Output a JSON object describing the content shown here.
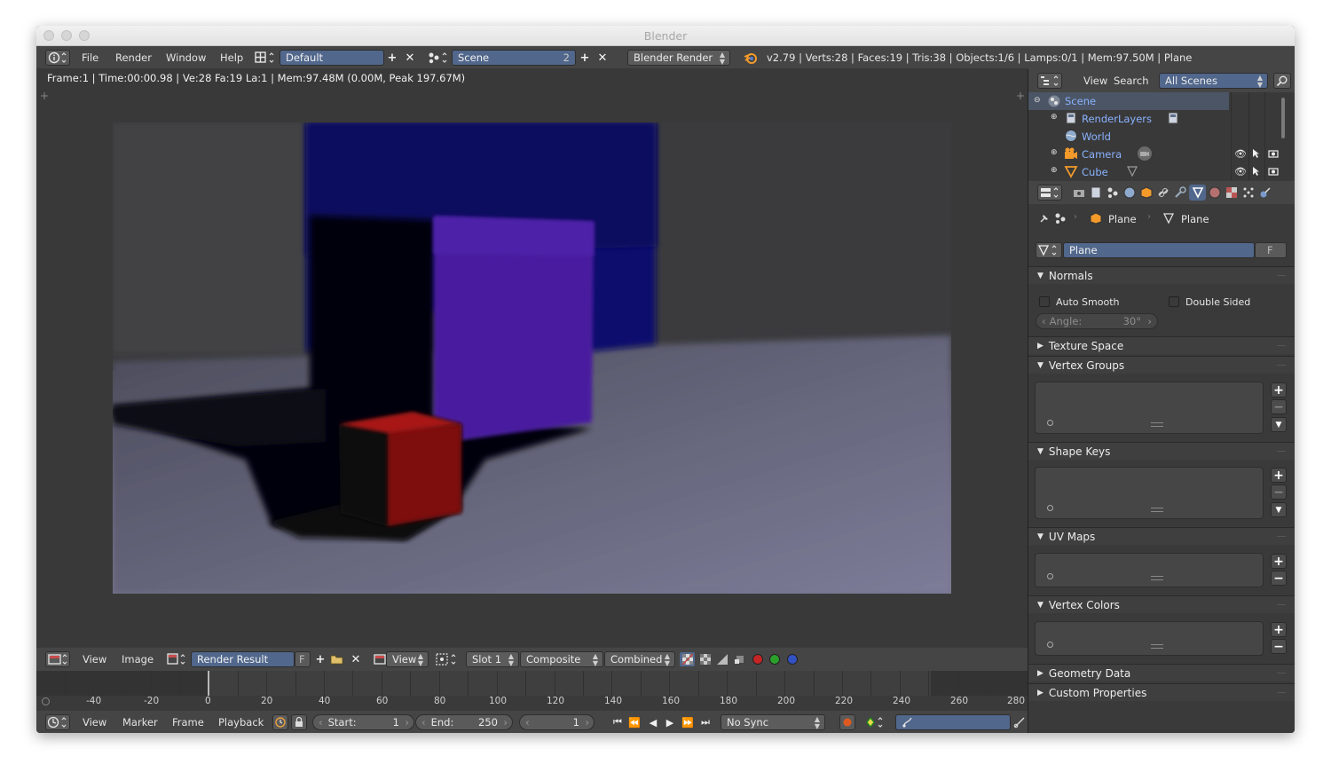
{
  "window": {
    "title": "Blender"
  },
  "menubar": {
    "items": [
      "File",
      "Render",
      "Window",
      "Help"
    ],
    "layout": "Default",
    "scene": "Scene",
    "scene_users": "2",
    "engine": "Blender Render",
    "stats": "v2.79 | Verts:28 | Faces:19 | Tris:38 | Objects:1/6 | Lamps:0/1 | Mem:97.50M | Plane"
  },
  "image_editor": {
    "info": "Frame:1 | Time:00:00.98 | Ve:28 Fa:19 La:1 | Mem:97.48M (0.00M, Peak 197.67M)",
    "header": {
      "view": "View",
      "image": "Image",
      "image_name": "Render Result",
      "fake_user": "F",
      "view_mode": "View",
      "slot": "Slot 1",
      "layer": "Composite",
      "pass": "Combined"
    }
  },
  "timeline": {
    "ticks": [
      "-40",
      "-20",
      "0",
      "20",
      "40",
      "60",
      "80",
      "100",
      "120",
      "140",
      "160",
      "180",
      "200",
      "220",
      "240",
      "260",
      "280"
    ],
    "header": {
      "menus": [
        "View",
        "Marker",
        "Frame",
        "Playback"
      ],
      "start_label": "Start:",
      "start_value": "1",
      "end_label": "End:",
      "end_value": "250",
      "current_frame": "1",
      "sync": "No Sync"
    }
  },
  "outliner": {
    "menus": [
      "View",
      "Search"
    ],
    "filter": "All Scenes",
    "items": [
      {
        "label": "Scene"
      },
      {
        "label": "RenderLayers"
      },
      {
        "label": "World"
      },
      {
        "label": "Camera"
      },
      {
        "label": "Cube"
      }
    ]
  },
  "properties": {
    "breadcrumb": [
      "Plane",
      "Plane"
    ],
    "datablock": "Plane",
    "datablock_fake": "F",
    "panels": {
      "normals": "Normals",
      "auto_smooth": "Auto Smooth",
      "double_sided": "Double Sided",
      "angle_label": "Angle:",
      "angle_value": "30°",
      "texture_space": "Texture Space",
      "vertex_groups": "Vertex Groups",
      "shape_keys": "Shape Keys",
      "uv_maps": "UV Maps",
      "vertex_colors": "Vertex Colors",
      "geometry_data": "Geometry Data",
      "custom_properties": "Custom Properties"
    }
  },
  "colors": {
    "accent": "#51678c",
    "outliner_text": "#8ab2ff",
    "background": "#3a3a3a"
  }
}
